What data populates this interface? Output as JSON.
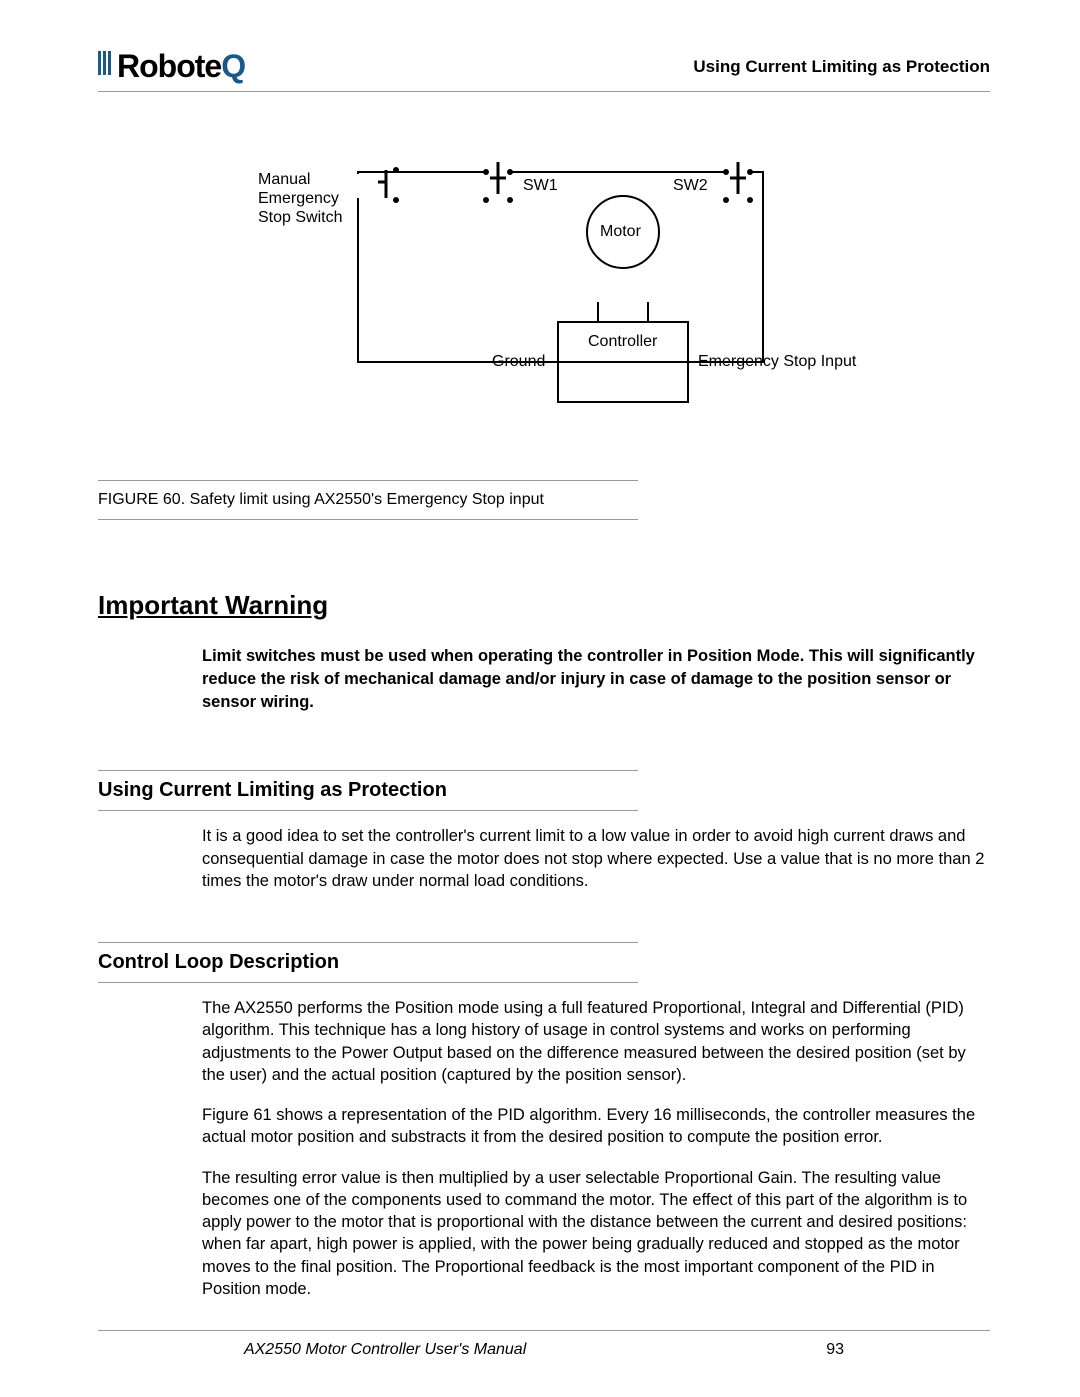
{
  "header": {
    "brand_1": "Robote",
    "brand_q": "Q",
    "section_title": "Using Current Limiting as Protection"
  },
  "diagram": {
    "manual_label_l1": "Manual",
    "manual_label_l2": "Emergency",
    "manual_label_l3": "Stop Switch",
    "sw1": "SW1",
    "sw2": "SW2",
    "motor": "Motor",
    "controller": "Controller",
    "ground": "Ground",
    "estop_input": "Emergency Stop Input"
  },
  "figure_caption": "FIGURE 60.  Safety limit using AX2550's Emergency Stop input",
  "warning": {
    "heading": "Important Warning",
    "body": "Limit switches must be used when operating the controller in Position Mode. This will significantly reduce the risk of mechanical damage and/or injury in case of damage to the position sensor or sensor wiring."
  },
  "section1": {
    "heading": "Using Current Limiting as Protection",
    "body": "It is a good idea to set the controller's current limit to a low value in order to avoid high current draws and consequential damage in case the motor does not stop where expected. Use a value that is no more than 2 times the motor's draw under normal load conditions."
  },
  "section2": {
    "heading": "Control Loop Description",
    "p1": "The AX2550 performs the Position mode using a full featured Proportional, Integral and Differential (PID) algorithm. This technique has a long history of usage in control systems and works on performing adjustments to the Power Output based on the difference measured between the desired position (set by the user) and the actual position (captured by the position sensor).",
    "p2": "Figure 61 shows a representation of the PID algorithm. Every 16 milliseconds, the controller measures the actual motor position and substracts it from the desired position to compute the position error.",
    "p3": "The resulting error value is then multiplied by a user selectable Proportional Gain. The resulting value becomes one of the components used to command the motor. The effect of this part of the algorithm is to apply power to the motor that is proportional with the distance between the current and desired positions: when far apart, high power is applied, with the power being gradually reduced and stopped as the motor moves to the final position. The Proportional feedback is the most important component of the PID in Position mode."
  },
  "footer": {
    "doc_title": "AX2550 Motor Controller User's Manual",
    "page": "93"
  }
}
